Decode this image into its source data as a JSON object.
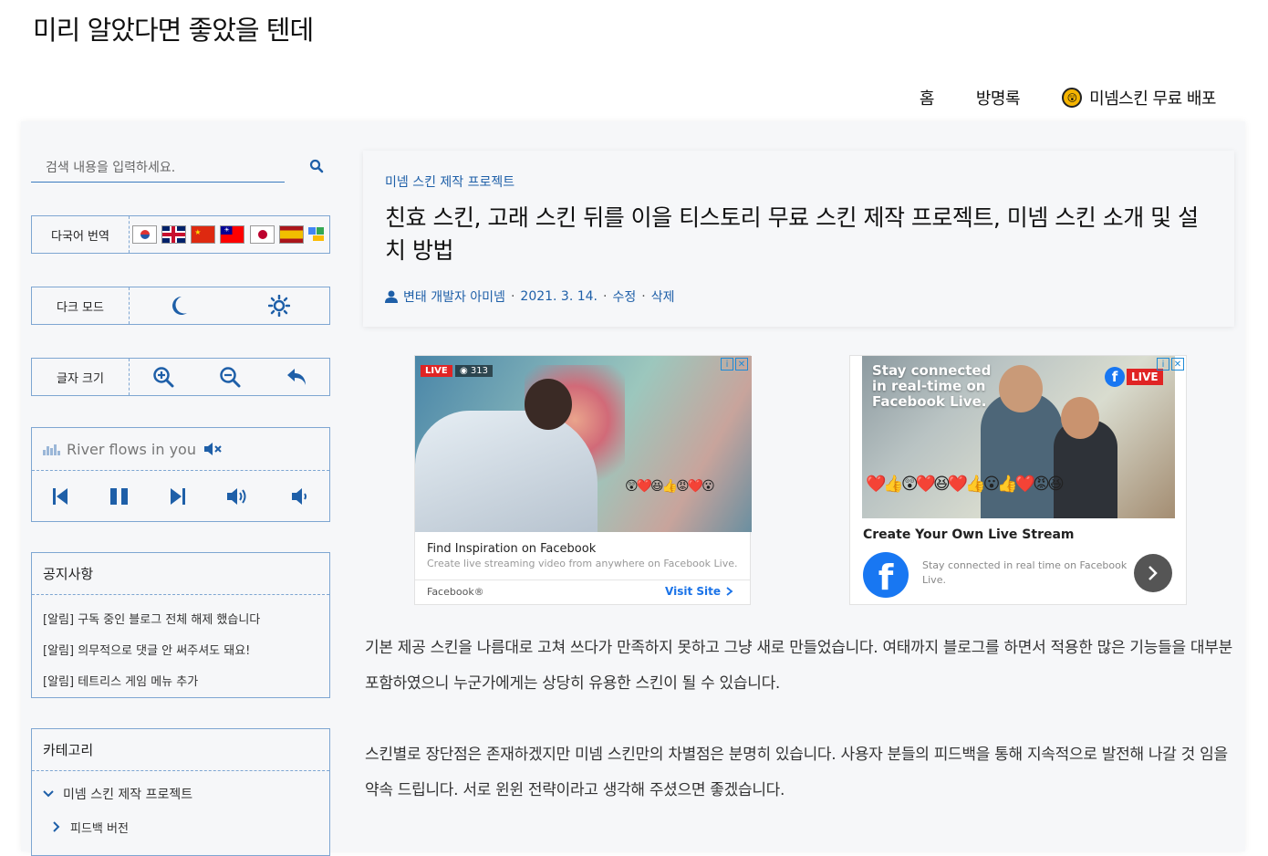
{
  "blog": {
    "title": "미리 알았다면 좋았을 텐데"
  },
  "nav": {
    "items": [
      "홈",
      "방명록",
      "미넴스킨 무료 배포"
    ]
  },
  "sidebar": {
    "search_placeholder": "검색 내용을 입력하세요.",
    "translate_label": "다국어 번역",
    "dark_label": "다크 모드",
    "font_label": "글자 크기",
    "music_title": "River flows in you",
    "notice_header": "공지사항",
    "notices": [
      "[알림] 구독 중인 블로그 전체 해제 했습니다",
      "[알림] 의무적으로 댓글 안 써주셔도 돼요!",
      "[알림] 테트리스 게임 메뉴 추가"
    ],
    "category_header": "카테고리",
    "categories": [
      "미넴 스킨 제작 프로젝트",
      "피드백 버전"
    ]
  },
  "post": {
    "category": "미넴 스킨 제작 프로젝트",
    "title": "친효 스킨, 고래 스킨 뒤를 이을 티스토리 무료 스킨 제작 프로젝트, 미넴 스킨 소개 및 설치 방법",
    "author": "변태 개발자 아미넴",
    "date": "2021. 3. 14.",
    "edit": "수정",
    "delete": "삭제",
    "paragraphs": [
      "기본 제공 스킨을 나름대로 고쳐 쓰다가 만족하지 못하고 그냥 새로 만들었습니다. 여태까지 블로그를 하면서 적용한 많은 기능들을 대부분 포함하였으니 누군가에게는 상당히 유용한 스킨이 될 수 있습니다.",
      "스킨별로 장단점은 존재하겠지만 미넴 스킨만의 차별점은 분명히 있습니다. 사용자 분들의 피드백을 통해 지속적으로 발전해 나갈 것 임을 약속 드립니다. 서로 윈윈 전략이라고 생각해 주셨으면 좋겠습니다."
    ]
  },
  "ads": {
    "left": {
      "live": "LIVE",
      "viewers": "313",
      "headline": "Find Inspiration on Facebook",
      "desc": "Create live streaming video from anywhere on Facebook Live.",
      "brand": "Facebook®",
      "cta": "Visit Site"
    },
    "right": {
      "overlay": "Stay connected in real-time on Facebook Live.",
      "live": "LIVE",
      "headline": "Create Your Own Live Stream",
      "desc": "Stay connected in real time on Facebook Live."
    }
  },
  "colors": {
    "accent": "#1e5fa8",
    "border": "#7ea6d2",
    "paper": "#f6f7f9"
  }
}
